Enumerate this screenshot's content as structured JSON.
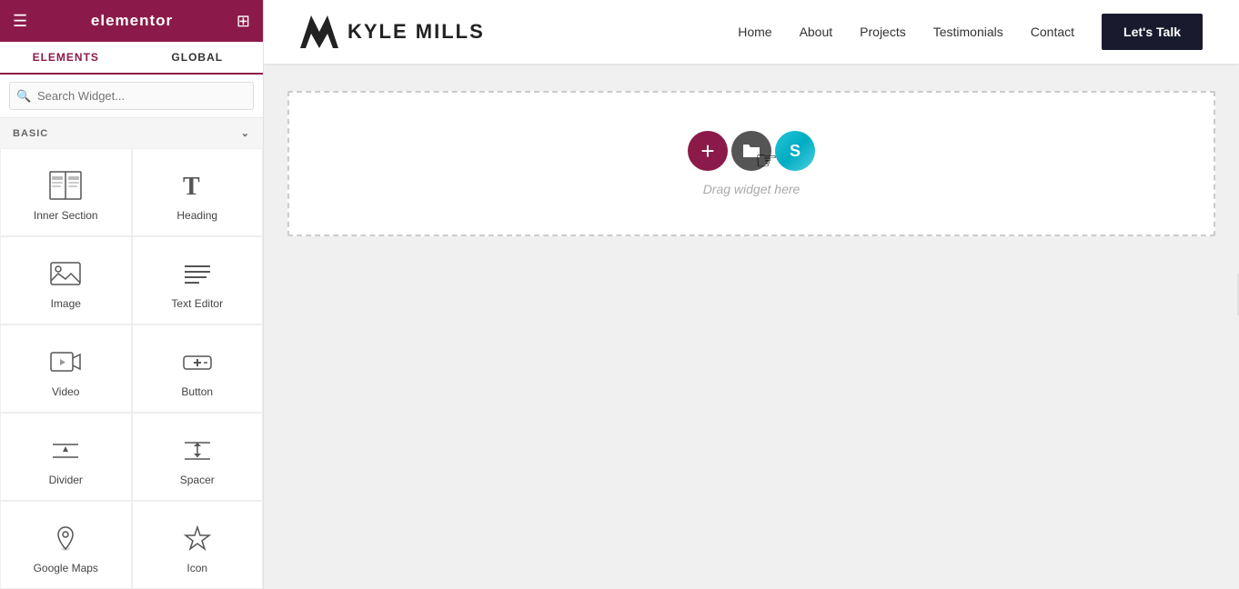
{
  "panel": {
    "header": {
      "title": "elementor",
      "hamburger_icon": "≡",
      "grid_icon": "⊞"
    },
    "tabs": [
      {
        "id": "elements",
        "label": "ELEMENTS",
        "active": true
      },
      {
        "id": "global",
        "label": "GLOBAL",
        "active": false
      }
    ],
    "search": {
      "placeholder": "Search Widget...",
      "value": ""
    },
    "section_basic": {
      "label": "BASIC",
      "collapsed": false
    },
    "widgets": [
      {
        "id": "inner-section",
        "label": "Inner Section",
        "icon": "inner_section"
      },
      {
        "id": "heading",
        "label": "Heading",
        "icon": "heading"
      },
      {
        "id": "image",
        "label": "Image",
        "icon": "image"
      },
      {
        "id": "text-editor",
        "label": "Text Editor",
        "icon": "text_editor"
      },
      {
        "id": "video",
        "label": "Video",
        "icon": "video"
      },
      {
        "id": "button",
        "label": "Button",
        "icon": "button"
      },
      {
        "id": "divider",
        "label": "Divider",
        "icon": "divider"
      },
      {
        "id": "spacer",
        "label": "Spacer",
        "icon": "spacer"
      },
      {
        "id": "google-maps",
        "label": "Google Maps",
        "icon": "google_maps"
      },
      {
        "id": "icon",
        "label": "Icon",
        "icon": "icon_widget"
      }
    ]
  },
  "site": {
    "logo_text": "KYLE MILLS",
    "nav": {
      "links": [
        "Home",
        "About",
        "Projects",
        "Testimonials",
        "Contact"
      ],
      "cta": "Let's Talk"
    },
    "canvas": {
      "drop_zone_text": "Drag widget here"
    }
  }
}
